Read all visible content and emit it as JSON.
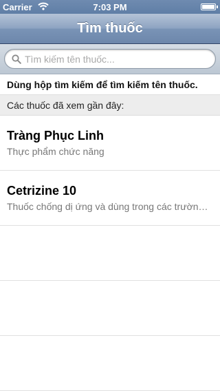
{
  "status_bar": {
    "carrier": "Carrier",
    "time": "7:03 PM"
  },
  "nav": {
    "title": "Tìm thuốc"
  },
  "search": {
    "placeholder": "Tìm kiếm tên thuốc...",
    "value": ""
  },
  "hint": "Dùng hộp tìm kiếm để tìm kiếm tên thuốc.",
  "section_header": "Các thuốc đã xem gần đây:",
  "recent": [
    {
      "title": "Tràng Phục Linh",
      "subtitle": "Thực phẩm chức năng"
    },
    {
      "title": "Cetrizine 10",
      "subtitle": "Thuốc chống dị ứng và dùng trong các trường hợp"
    }
  ],
  "icons": {
    "wifi": "wifi-icon",
    "battery": "battery-icon",
    "search": "search-icon"
  },
  "colors": {
    "nav_bar": "#7993b6",
    "status_bar": "#5f7ea6",
    "search_bar": "#c9d2dc",
    "section_header": "#ededed"
  }
}
